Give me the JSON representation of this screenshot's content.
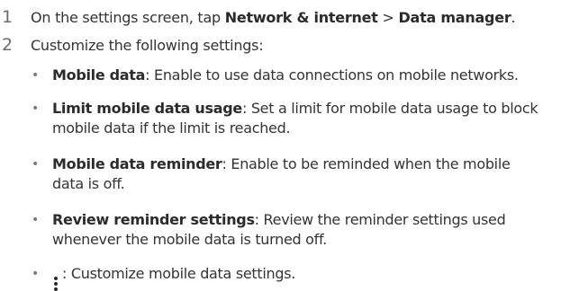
{
  "steps": [
    {
      "num": "1",
      "pre": "On the settings screen, tap ",
      "bold1": "Network & internet",
      "sep": " > ",
      "bold2": "Data manager",
      "post": "."
    },
    {
      "num": "2",
      "text": "Customize the following settings:"
    }
  ],
  "items": [
    {
      "bullet": "•",
      "term": "Mobile data",
      "desc": ": Enable to use data connections on mobile networks."
    },
    {
      "bullet": "•",
      "term": "Limit mobile data usage",
      "desc": ": Set a limit for mobile data usage to block",
      "desc2": "mobile data if the limit is reached."
    },
    {
      "bullet": "•",
      "term": "Mobile data reminder",
      "desc": ": Enable to be reminded when the mobile",
      "desc2": "data is off."
    },
    {
      "bullet": "•",
      "term": "Review reminder settings",
      "desc": ": Review the reminder settings used",
      "desc2": "whenever the mobile data is turned off."
    },
    {
      "bullet": "•",
      "icon": "more-options-icon",
      "desc": ": Customize mobile data settings."
    }
  ]
}
